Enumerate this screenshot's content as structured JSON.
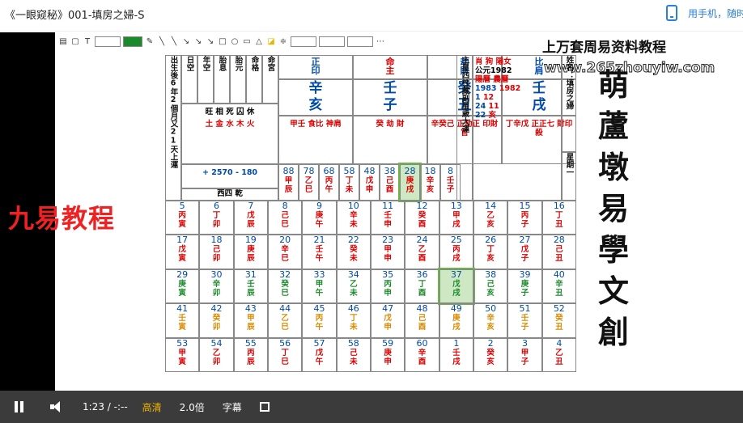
{
  "page": {
    "title": "《一眼窥秘》001-填房之婦-S",
    "phone_prompt": "用手机，随时"
  },
  "overlay": {
    "top_text": "上万套周易资料教程",
    "url_text": "www.265zhouyiw.com",
    "brand": "九易教程",
    "vertical_title": [
      "萌",
      "蘆",
      "墩",
      "易",
      "學",
      "文",
      "創"
    ]
  },
  "player": {
    "time": "1:23 / -:--",
    "quality": "高清",
    "speed": "2.0倍",
    "subtitle": "字幕"
  },
  "chart": {
    "left_headers": [
      "出生後6年2個月又21天上運",
      "日空",
      "年空",
      "胎息",
      "胎元",
      "命格",
      "命宮"
    ],
    "pillars_head": [
      {
        "top": "正",
        "bot": "印",
        "color": "blue"
      },
      {
        "top": "命",
        "bot": "主",
        "color": "red"
      },
      {
        "top": "劫",
        "bot": "財",
        "color": "blue"
      },
      {
        "top": "比",
        "bot": "肩",
        "color": "blue"
      }
    ],
    "stems": [
      {
        "t": "辛",
        "c": "blue"
      },
      {
        "t": "壬",
        "c": "blue"
      },
      {
        "t": "癸",
        "c": "blue"
      },
      {
        "t": "壬",
        "c": "blue"
      }
    ],
    "branches": [
      {
        "t": "亥",
        "c": "blue"
      },
      {
        "t": "子",
        "c": "blue"
      },
      {
        "t": "丑",
        "c": "blue"
      },
      {
        "t": "戌",
        "c": "blue"
      }
    ],
    "hidden": [
      "甲壬 食比 神肩",
      "癸 劫 財",
      "辛癸己 正劫正 印財官",
      "丁辛戊 正正七 財印殺"
    ],
    "right_labels": [
      "主星",
      "四柱",
      "藏",
      "副星",
      "歲",
      "大運"
    ],
    "dates": {
      "sun_label": "肖 狗",
      "moon_label": "陽女",
      "sun_year": "公元1982",
      "yang": "陽曆",
      "yang_year": "1983",
      "yang_month": "1",
      "yang_day": "24",
      "yang_hour": "22",
      "nong": "農曆",
      "nong_year": "1982",
      "nong_month": "12",
      "nong_day": "11",
      "nong_hour": "亥",
      "name": "姓名：填房之婦",
      "week": "星期一"
    },
    "ages": [
      "88",
      "78",
      "68",
      "58",
      "48",
      "38",
      "28",
      "18",
      "8"
    ],
    "dayun": [
      "甲辰",
      "乙巳",
      "丙午",
      "丁未",
      "戊申",
      "己酉",
      "庚戌",
      "辛亥",
      "壬子"
    ],
    "wuxing": [
      "旺 相 死 囚 休",
      "土 金 水 木 火"
    ],
    "numbers": "+ 2570  - 180",
    "footer": "西四 乾",
    "years": [
      [
        "5",
        "6",
        "7",
        "8",
        "9",
        "10",
        "11",
        "12",
        "13",
        "14",
        "15",
        "16"
      ],
      [
        "17",
        "18",
        "19",
        "20",
        "21",
        "22",
        "23",
        "24",
        "25",
        "26",
        "27",
        "28"
      ],
      [
        "29",
        "30",
        "31",
        "32",
        "33",
        "34",
        "35",
        "36",
        "37",
        "38",
        "39",
        "40"
      ],
      [
        "41",
        "42",
        "43",
        "44",
        "45",
        "46",
        "47",
        "48",
        "49",
        "50",
        "51",
        "52"
      ],
      [
        "53",
        "54",
        "55",
        "56",
        "57",
        "58",
        "59",
        "60",
        "1",
        "2",
        "3",
        "4"
      ]
    ],
    "year_gz": [
      [
        "丙寅",
        "丁卯",
        "戊辰",
        "己巳",
        "庚午",
        "辛未",
        "壬申",
        "癸酉",
        "甲戌",
        "乙亥",
        "丙子",
        "丁丑"
      ],
      [
        "戊寅",
        "己卯",
        "庚辰",
        "辛巳",
        "壬午",
        "癸未",
        "甲申",
        "乙酉",
        "丙戌",
        "丁亥",
        "戊子",
        "己丑"
      ],
      [
        "庚寅",
        "辛卯",
        "壬辰",
        "癸巳",
        "甲午",
        "乙未",
        "丙申",
        "丁酉",
        "戊戌",
        "己亥",
        "庚子",
        "辛丑"
      ],
      [
        "壬寅",
        "癸卯",
        "甲辰",
        "乙巳",
        "丙午",
        "丁未",
        "戊申",
        "己酉",
        "庚戌",
        "辛亥",
        "壬子",
        "癸丑"
      ],
      [
        "甲寅",
        "乙卯",
        "丙辰",
        "丁巳",
        "戊午",
        "己未",
        "庚申",
        "辛酉",
        "壬戌",
        "癸亥",
        "甲子",
        "乙丑"
      ]
    ]
  }
}
